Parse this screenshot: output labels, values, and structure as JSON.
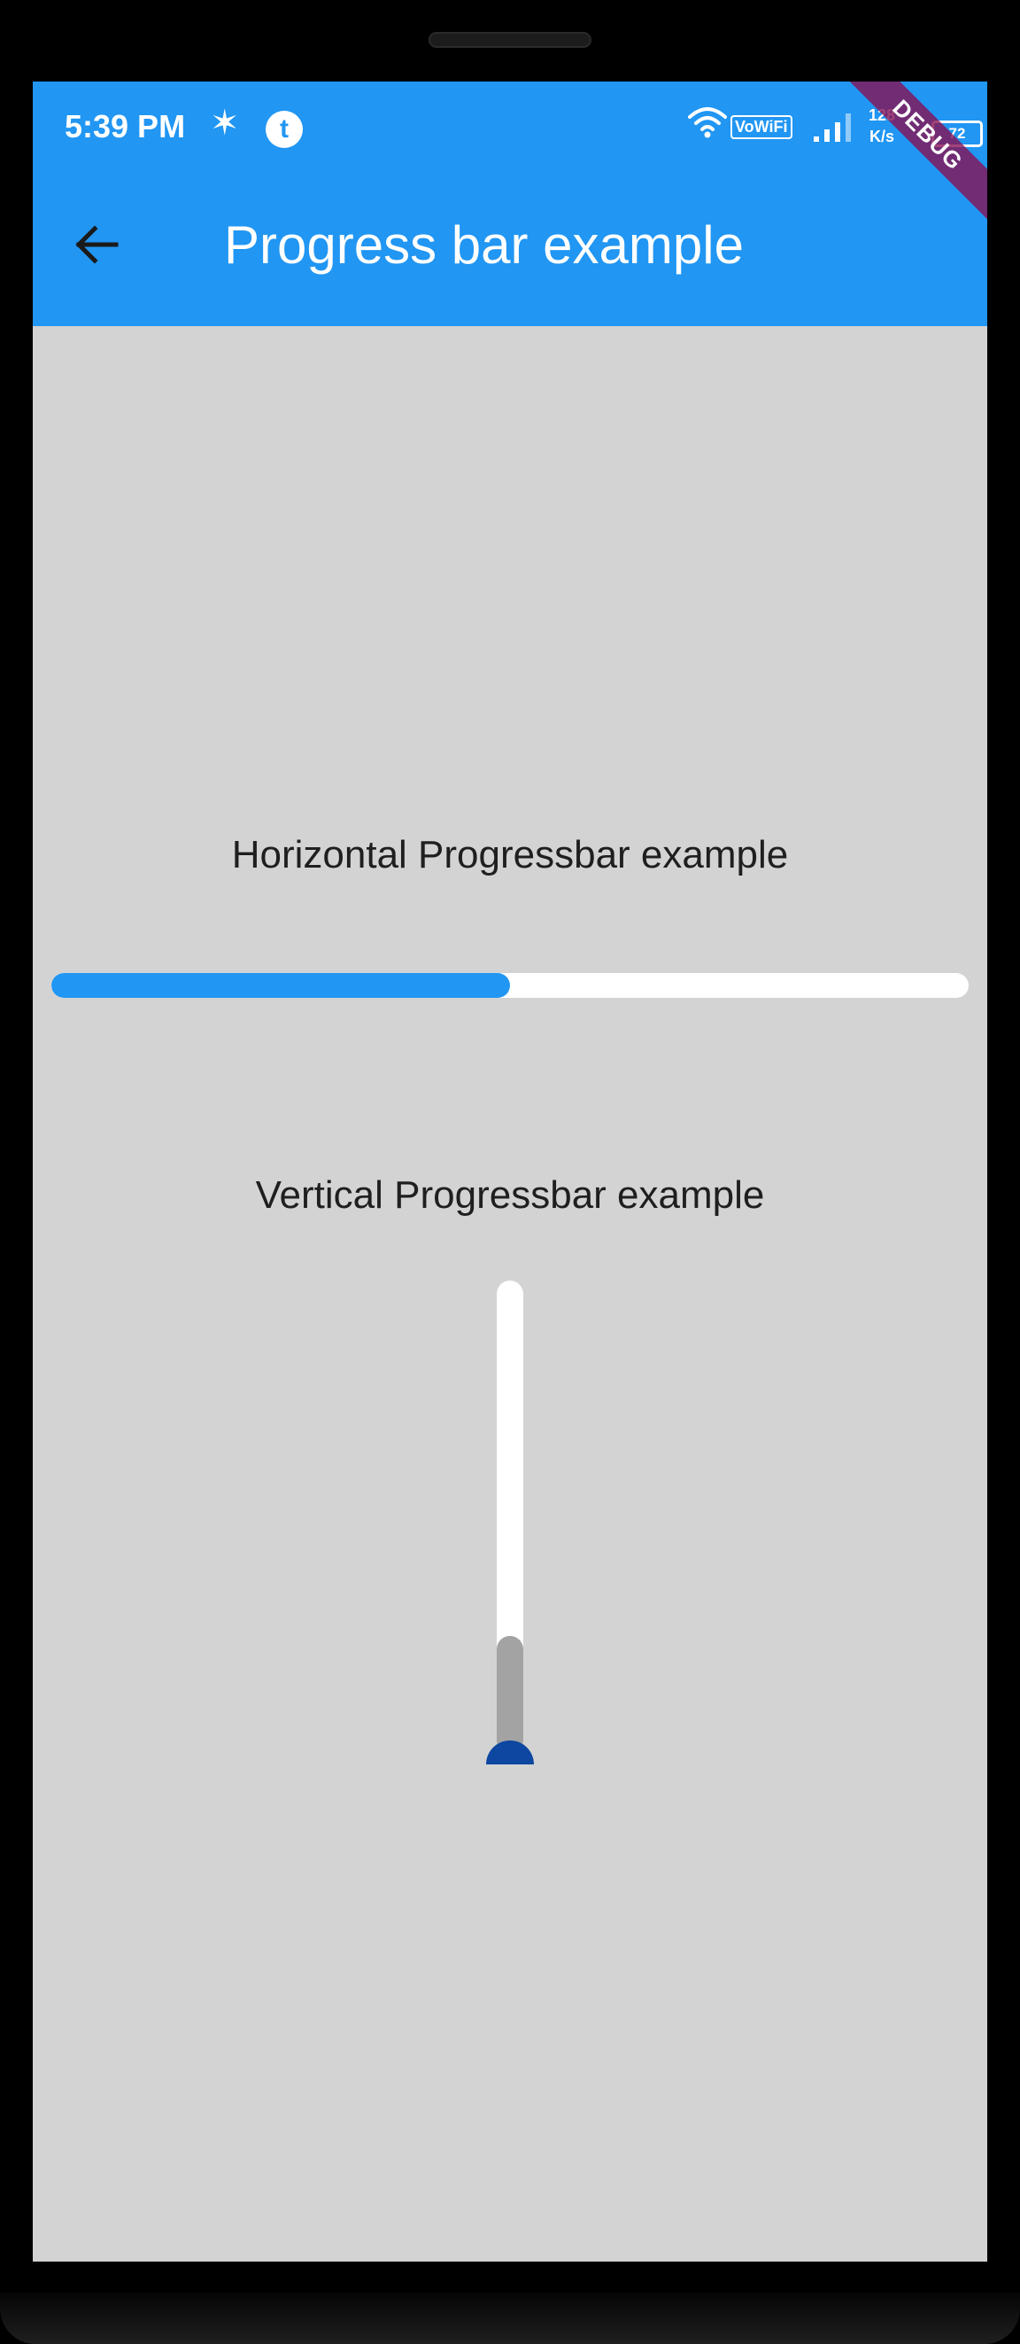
{
  "status_bar": {
    "time": "5:39 PM",
    "vowifi": "VoWiFi",
    "net_speed_value": "128",
    "net_speed_unit": "K/s",
    "battery": "72"
  },
  "debug_banner": "DEBUG",
  "app_bar": {
    "title": "Progress bar example",
    "back_icon": "arrow-back-icon",
    "color": "#2196f3"
  },
  "horizontal": {
    "label": "Horizontal Progressbar example",
    "progress": 0.5,
    "fill_color": "#2196f3",
    "track_color": "#ffffff"
  },
  "vertical": {
    "label": "Vertical Progressbar example",
    "progress": 0.25,
    "fill_color": "#a3a3a3",
    "track_color": "#ffffff",
    "knob_color": "#0d47a1"
  },
  "background_color": "#d3d3d3"
}
